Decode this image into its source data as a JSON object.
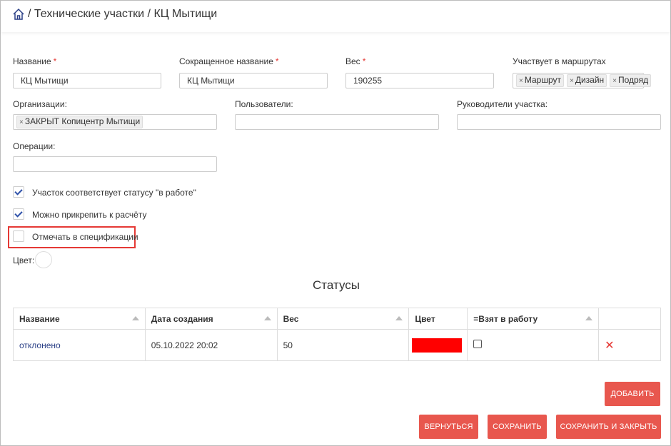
{
  "breadcrumb": {
    "home_icon": "home-icon",
    "text": "/ Технические участки / КЦ Мытищи"
  },
  "form": {
    "name": {
      "label": "Название",
      "required": "*",
      "value": "КЦ Мытищи"
    },
    "short_name": {
      "label": "Сокращенное название",
      "required": "*",
      "value": "КЦ Мытищи"
    },
    "weight": {
      "label": "Вес",
      "required": "*",
      "value": "190255"
    },
    "routes": {
      "label": "Участвует в маршрутах",
      "tags": [
        "Маршрут",
        "Дизайн",
        "Подряд"
      ]
    },
    "organizations": {
      "label": "Организации:",
      "tags": [
        "ЗАКРЫТ Копицентр Мытищи"
      ]
    },
    "users": {
      "label": "Пользователи:",
      "value": ""
    },
    "managers": {
      "label": "Руководители участка:",
      "value": ""
    },
    "operations": {
      "label": "Операции:",
      "value": ""
    },
    "checkboxes": [
      {
        "label": "Участок соответствует статусу \"в работе\"",
        "checked": true
      },
      {
        "label": "Можно прикрепить к расчёту",
        "checked": true
      },
      {
        "label": "Отмечать в спецификации",
        "checked": false
      }
    ],
    "color_label": "Цвет:"
  },
  "statuses": {
    "title": "Статусы",
    "columns": [
      "Название",
      "Дата создания",
      "Вес",
      "Цвет",
      "=Взят в работу",
      ""
    ],
    "rows": [
      {
        "name": "отклонено",
        "created": "05.10.2022 20:02",
        "weight": "50",
        "color": "#ff0000",
        "in_work": false
      }
    ]
  },
  "buttons": {
    "add": "ДОБАВИТЬ",
    "back": "ВЕРНУТЬСЯ",
    "save": "СОХРАНИТЬ",
    "save_close": "СОХРАНИТЬ И ЗАКРЫТЬ"
  },
  "colors": {
    "accent": "#e8574e",
    "highlight": "#e53935",
    "link": "#2a3f86"
  }
}
